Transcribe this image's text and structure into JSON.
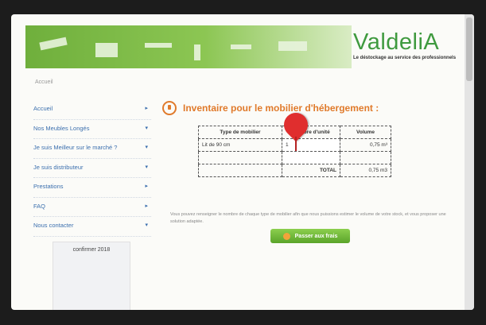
{
  "logo": {
    "text": "ValdeliA",
    "tagline": "Le déstockage au service des professionnels"
  },
  "breadcrumb": "Accueil",
  "sidebar": {
    "items": [
      {
        "label": "Accueil",
        "arrow": "▸"
      },
      {
        "label": "Nos Meubles Longés",
        "arrow": "▾"
      },
      {
        "label": "Je suis Meilleur sur le marché ?",
        "arrow": "▾"
      },
      {
        "label": "Je suis distributeur",
        "arrow": "▾"
      },
      {
        "label": "Prestations",
        "arrow": "▸"
      },
      {
        "label": "FAQ",
        "arrow": "▸"
      },
      {
        "label": "Nous contacter",
        "arrow": "▾"
      }
    ],
    "box_title": "confirmer 2018"
  },
  "main": {
    "title": "Inventaire pour le mobilier d'hébergement :",
    "table": {
      "headers": [
        "Type de mobilier",
        "Nombre d'unité",
        "Volume"
      ],
      "rows": [
        {
          "type": "Lit de 90 cm",
          "qty": "1",
          "volume": "0,75 m³"
        },
        {
          "type": "",
          "qty": "",
          "volume": ""
        }
      ],
      "total_label": "TOTAL",
      "total_value": "0,75 m3"
    },
    "note": "Vous pouvez renseigner le nombre de chaque type de mobilier afin que nous puissions estimer le volume de votre stock, et vous proposer une solution adaptée.",
    "button_label": "Passer aux frais"
  },
  "colors": {
    "accent_orange": "#e07a2b",
    "brand_green": "#3f9a3f",
    "link_blue": "#3b6fae",
    "pin_red": "#e02e2e"
  }
}
